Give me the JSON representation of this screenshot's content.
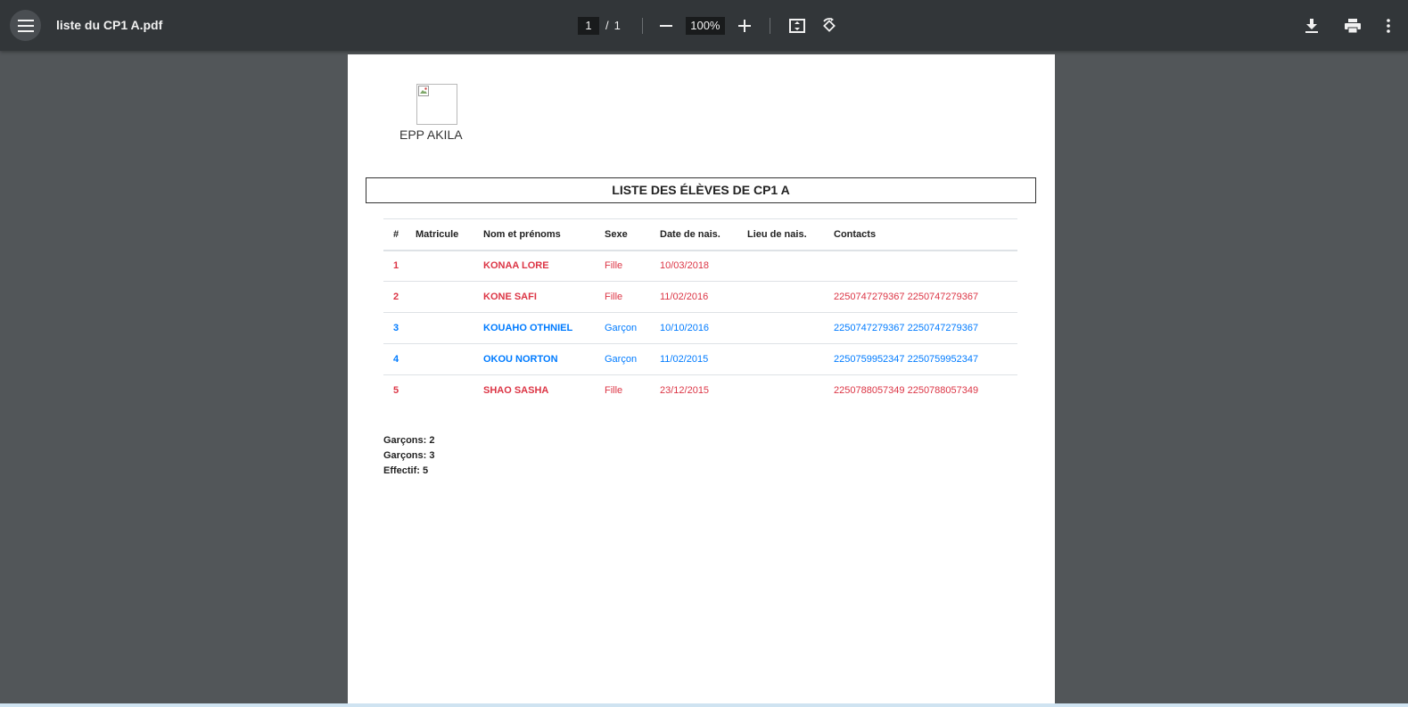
{
  "toolbar": {
    "file_name": "liste du CP1 A.pdf",
    "current_page": "1",
    "page_separator": "/",
    "total_pages": "1",
    "zoom": "100%"
  },
  "document": {
    "school_name": "EPP AKILA",
    "title": "LISTE DES ÉLÈVES DE CP1 A",
    "table": {
      "headers": [
        "#",
        "Matricule",
        "Nom et prénoms",
        "Sexe",
        "Date de nais.",
        "Lieu de nais.",
        "Contacts"
      ],
      "rows": [
        {
          "num": "1",
          "matricule": "",
          "nom": "KONAA LORE",
          "sexe": "Fille",
          "date": "10/03/2018",
          "lieu": "",
          "contacts": "",
          "color": "#dc3545"
        },
        {
          "num": "2",
          "matricule": "",
          "nom": "KONE SAFI",
          "sexe": "Fille",
          "date": "11/02/2016",
          "lieu": "",
          "contacts": "2250747279367 2250747279367",
          "color": "#dc3545"
        },
        {
          "num": "3",
          "matricule": "",
          "nom": "KOUAHO OTHNIEL",
          "sexe": "Garçon",
          "date": "10/10/2016",
          "lieu": "",
          "contacts": "2250747279367 2250747279367",
          "color": "#007bff"
        },
        {
          "num": "4",
          "matricule": "",
          "nom": "OKOU NORTON",
          "sexe": "Garçon",
          "date": "11/02/2015",
          "lieu": "",
          "contacts": "2250759952347 2250759952347",
          "color": "#007bff"
        },
        {
          "num": "5",
          "matricule": "",
          "nom": "SHAO SASHA",
          "sexe": "Fille",
          "date": "23/12/2015",
          "lieu": "",
          "contacts": "2250788057349 2250788057349",
          "color": "#dc3545"
        }
      ]
    },
    "totals": {
      "line1": "Garçons: 2",
      "line2": "Garçons: 3",
      "line3": "Effectif: 5"
    }
  },
  "icons": {
    "menu": "menu-icon",
    "zoom_out": "minus-icon",
    "zoom_in": "plus-icon",
    "fit": "fit-page-icon",
    "rotate": "rotate-icon",
    "download": "download-icon",
    "print": "print-icon",
    "more": "more-vert-icon"
  }
}
